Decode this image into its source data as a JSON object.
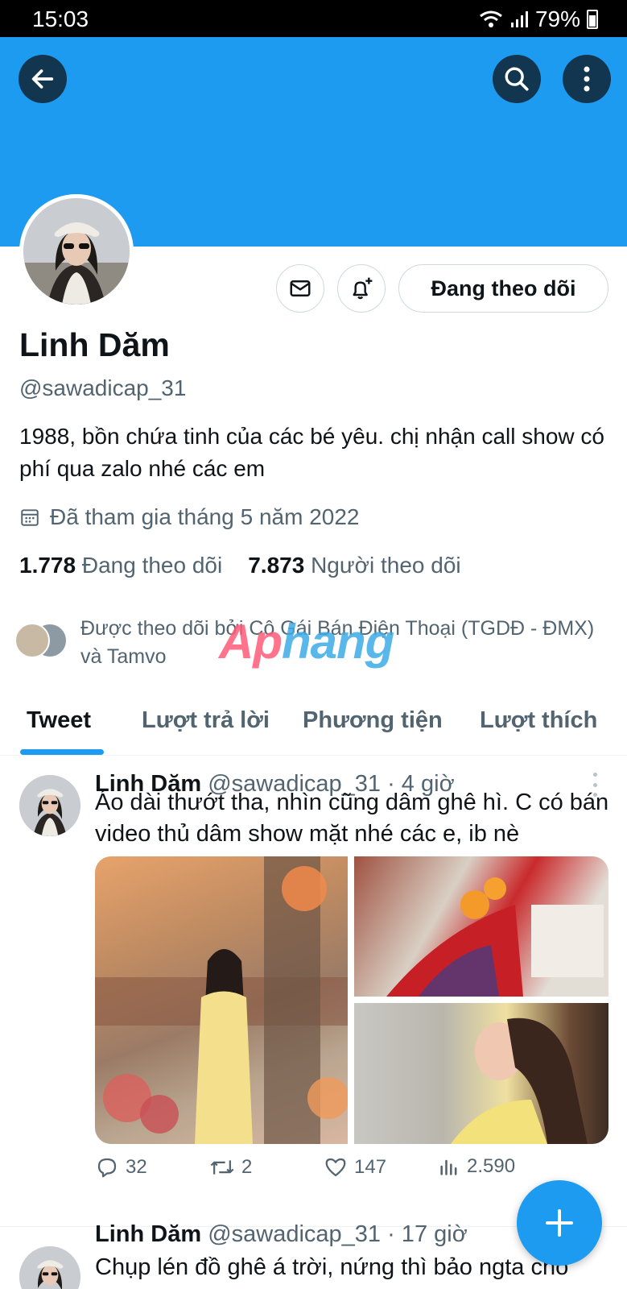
{
  "status_bar": {
    "time": "15:03",
    "battery": "79%"
  },
  "profile": {
    "name": "Linh Dăm",
    "handle": "@sawadicap_31",
    "bio": "1988, bồn chứa tinh của các bé yêu. chị nhận call show có phí qua zalo nhé các em",
    "joined": "Đã tham gia tháng 5 năm 2022",
    "following_count": "1.778",
    "following_label": "Đang theo dõi",
    "followers_count": "7.873",
    "followers_label": "Người theo dõi",
    "followed_by": "Được theo dõi bởi Cô Gái Bán Điện Thoại (TGDĐ - ĐMX) và Tamvo",
    "follow_button": "Đang theo dõi"
  },
  "watermark": {
    "part1": "Ap",
    "part2": "hang"
  },
  "tabs": [
    "Tweet",
    "Lượt trả lời",
    "Phương tiện",
    "Lượt thích"
  ],
  "tweets": [
    {
      "name": "Linh Dăm",
      "meta": "@sawadicap_31 · 4 giờ",
      "text": "Áo dài thướt tha, nhìn cũng dâm ghê hì. C có bán video thủ dâm show mặt nhé các e, ib nè",
      "replies": "32",
      "retweets": "2",
      "likes": "147",
      "views": "2.590"
    },
    {
      "name": "Linh Dăm",
      "meta": "@sawadicap_31 · 17 giờ",
      "text": "Chụp lén đồ ghê á trời, nứng thì bảo ngta cho"
    }
  ],
  "icons": {
    "back": "arrow-left-icon",
    "search": "search-icon",
    "more": "more-vertical-icon",
    "message": "mail-icon",
    "notify": "bell-plus-icon",
    "calendar": "calendar-icon",
    "reply": "reply-icon",
    "retweet": "retweet-icon",
    "like": "heart-icon",
    "views": "views-chart-icon",
    "compose": "plus-icon"
  },
  "colors": {
    "accent": "#1d9bf0",
    "text": "#0f1419",
    "muted": "#536471"
  }
}
